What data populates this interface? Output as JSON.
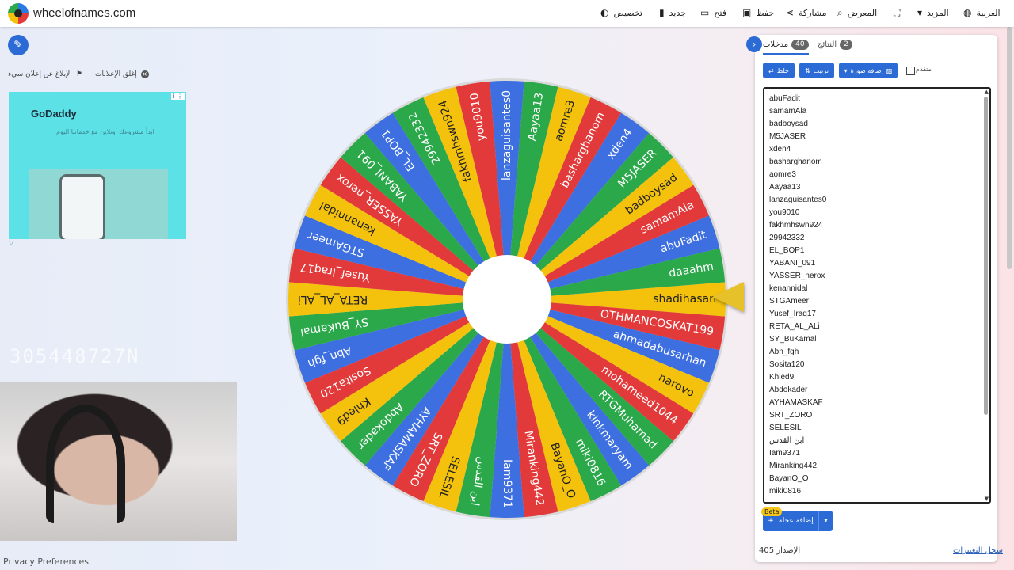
{
  "header": {
    "brand": "wheelofnames.com",
    "menu": [
      {
        "label": "العربية",
        "icon": "globe-icon"
      },
      {
        "label": "المزيد",
        "icon": "caret-down-icon"
      },
      {
        "label": "",
        "icon": "fullscreen-icon"
      },
      {
        "label": "المعرض",
        "icon": "search-icon"
      },
      {
        "label": "مشاركة",
        "icon": "share-icon"
      },
      {
        "label": "حفظ",
        "icon": "save-icon"
      },
      {
        "label": "فتح",
        "icon": "folder-icon"
      },
      {
        "label": "جديد",
        "icon": "file-icon"
      },
      {
        "label": "تخصيص",
        "icon": "palette-icon"
      }
    ]
  },
  "ads": {
    "report_label": "الإبلاغ عن إعلان سيء",
    "close_label": "إغلق الإعلانات",
    "ad_brand": "GoDaddy",
    "ad_sub": "ابدأ مشروعك أونلاين مع خدماتنا اليوم",
    "ad_info": "i ⋮"
  },
  "overlay_text": "305448727N",
  "privacy": "Privacy Preferences",
  "panel": {
    "tab_entries": "مدخلات",
    "tab_entries_count": "40",
    "tab_results": "النتائج",
    "tab_results_count": "2",
    "shuffle_label": "خلط",
    "sort_label": "ترتيب",
    "add_image_label": "إضافة صورة",
    "advanced_label": "متقدم",
    "add_wheel_label": "إضافة عجلة",
    "beta": "Beta",
    "version": "الإصدار 405",
    "changelog": "سجل التغييرات"
  },
  "entries": [
    "abuFadit",
    "samamAla",
    "badboysad",
    "M5JASER",
    "xden4",
    "basharghanom",
    "aomre3",
    "Aayaa13",
    "lanzaguisantes0",
    "you9010",
    "fakhmhswn924",
    "29942332",
    "EL_BOP1",
    "YABANI_091",
    "YASSER_nerox",
    "kenannidal",
    "STGAmeer",
    "Yusef_Iraq17",
    "RETA_AL_ALi",
    "SY_BuKamal",
    "Abn_fgh",
    "Sosita120",
    "Khled9",
    "Abdokader",
    "AYHAMASKAF",
    "SRT_ZORO",
    "SELESIL",
    "ابن القدس",
    "Iam9371",
    "Miranking442",
    "BayanO_O",
    "miki0816"
  ],
  "wheel": {
    "segments": [
      "shadihasan",
      "OTHMANCOSKAT199",
      "ahmadabusarhan",
      "narovo",
      "mohameed1044",
      "RTGMuhamad",
      "kinkmaryam",
      "miki0816",
      "BayanO_O",
      "Miranking442",
      "Iam9371",
      "ابن القدس",
      "SELESIL",
      "SRT_ZORO",
      "AYHAMASKAF",
      "Abdokader",
      "Khled9",
      "Sosita120",
      "Abn_fgh",
      "SY_BuKamal",
      "RETA_AL_ALi",
      "Yusef_Iraq17",
      "STGAmeer",
      "kenannidal",
      "YASSER_nerox",
      "YABANI_091",
      "EL_BOP1",
      "29942332",
      "fakhmhswn924",
      "you9010",
      "lanzaguisantes0",
      "Aayaa13",
      "aomre3",
      "basharghanom",
      "xden4",
      "M5JASER",
      "badboysad",
      "samamAla",
      "abuFadit",
      "daaahm"
    ],
    "colors": [
      "#f4c20d",
      "#e23a3a",
      "#3d6fe0",
      "#f4c20d",
      "#e23a3a",
      "#2aa84a",
      "#3d6fe0",
      "#2aa84a",
      "#f4c20d",
      "#e23a3a",
      "#3d6fe0",
      "#2aa84a",
      "#f4c20d",
      "#e23a3a",
      "#3d6fe0",
      "#2aa84a",
      "#f4c20d",
      "#e23a3a",
      "#3d6fe0",
      "#2aa84a"
    ]
  }
}
